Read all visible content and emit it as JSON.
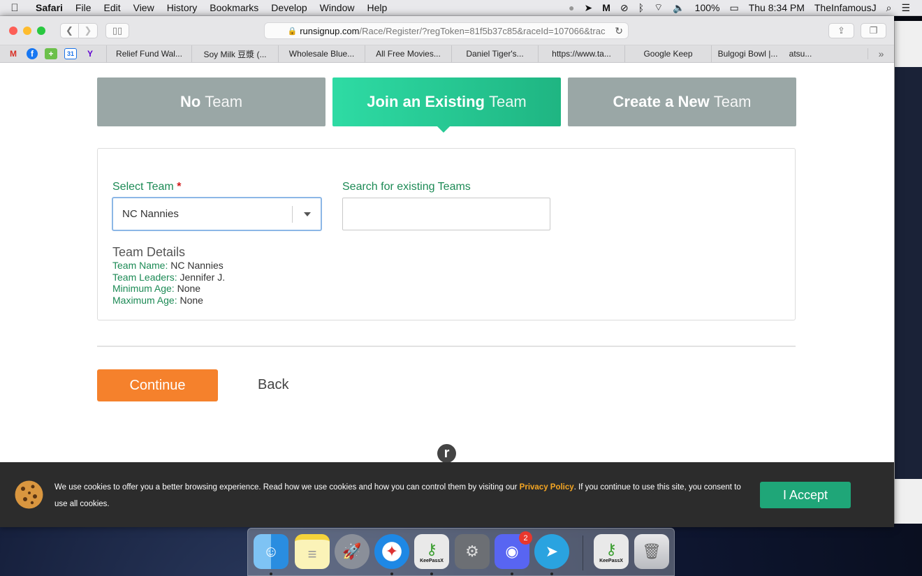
{
  "menubar": {
    "app": "Safari",
    "items": [
      "File",
      "Edit",
      "View",
      "History",
      "Bookmarks",
      "Develop",
      "Window",
      "Help"
    ],
    "battery": "100%",
    "clock": "Thu 8:34 PM",
    "user": "TheInfamousJ"
  },
  "browser": {
    "url_host": "runsignup.com",
    "url_path": "/Race/Register/?regToken=81f5b37c85&raceId=107066&trac",
    "bookmarks": [
      "Relief Fund Wal...",
      "Soy Milk 豆漿 (...",
      "Wholesale Blue...",
      "All Free Movies...",
      "Daniel Tiger's...",
      "https://www.ta...",
      "Google Keep",
      "Bulgogi Bowl |...",
      "atsu..."
    ],
    "bookmark_more": "»"
  },
  "team_tabs": {
    "none": {
      "bold": "No",
      "light": "Team"
    },
    "join": {
      "bold": "Join an Existing",
      "light": "Team"
    },
    "create": {
      "bold": "Create a New",
      "light": "Team"
    }
  },
  "form": {
    "select_label": "Select Team",
    "required_mark": "*",
    "select_value": "NC Nannies",
    "search_label": "Search for existing Teams",
    "search_value": "",
    "details_title": "Team Details",
    "details": [
      {
        "key": "Team Name:",
        "value": "NC Nannies"
      },
      {
        "key": "Team Leaders:",
        "value": "Jennifer J."
      },
      {
        "key": "Minimum Age:",
        "value": "None"
      },
      {
        "key": "Maximum Age:",
        "value": "None"
      }
    ]
  },
  "actions": {
    "continue": "Continue",
    "back": "Back"
  },
  "cookie": {
    "text_before": "We use cookies to offer you a better browsing experience. Read how we use cookies and how you can control them by visiting our",
    "link": "Privacy Policy",
    "text_after": ". If you continue to use this site, you consent to use all cookies.",
    "accept": "I Accept"
  },
  "dock": {
    "apps": [
      "finder-icon",
      "notes-icon",
      "launchpad-icon",
      "safari-icon",
      "keepassx-icon",
      "system-preferences-icon",
      "discord-icon",
      "telegram-icon",
      "keepassx-icon",
      "trash-icon"
    ],
    "discord_badge": "2",
    "keepassx_label": "KeePassX"
  },
  "colors": {
    "accent_green": "#1fb582",
    "label_green": "#1c8a55",
    "continue_orange": "#f5812c",
    "tab_gray": "#9aa7a6"
  }
}
